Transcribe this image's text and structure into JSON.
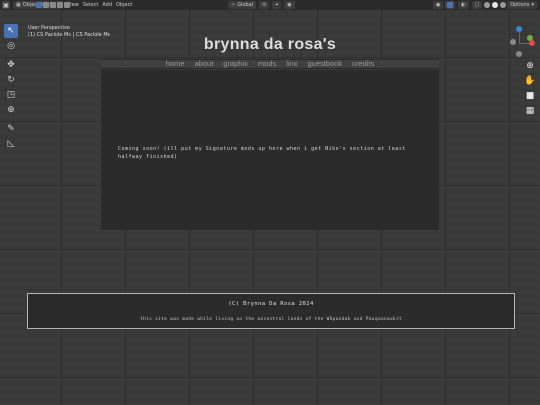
{
  "header": {
    "editor_icon": "viewport-icon",
    "mode_label": "Object Mode",
    "menus": [
      "View",
      "Select",
      "Add",
      "Object"
    ],
    "transform_orientation": "Global",
    "options_label": "Options"
  },
  "viewport": {
    "perspective_label": "User Perspective",
    "collection_label": "(1) CS Paclole Mc | CS Paclole Mc"
  },
  "toolbar": {
    "tools": [
      {
        "name": "select-box-icon",
        "glyph": "↖",
        "active": true
      },
      {
        "name": "cursor-icon",
        "glyph": "◎",
        "active": false
      },
      {
        "name": "move-icon",
        "glyph": "✥",
        "active": false
      },
      {
        "name": "rotate-icon",
        "glyph": "↻",
        "active": false
      },
      {
        "name": "scale-icon",
        "glyph": "◳",
        "active": false
      },
      {
        "name": "transform-icon",
        "glyph": "⊕",
        "active": false
      },
      {
        "name": "annotate-icon",
        "glyph": "✎",
        "active": false
      },
      {
        "name": "measure-icon",
        "glyph": "📐",
        "active": false
      }
    ]
  },
  "gizmo": {
    "colors": {
      "x": "#e04a4a",
      "y": "#6fb13c",
      "z": "#3e86d8",
      "neg": "#8a8a8a"
    }
  },
  "site": {
    "title": "brynna da rosa's",
    "nav": [
      "home",
      "about",
      "graphix",
      "mods",
      "linx",
      "guestbook",
      "credits"
    ],
    "content": "Coming soon! (ill put my Signature mods up here when i get Niko's section at least halfway finished)",
    "footer_copy": "(C) Brynna Da Rosa 2024",
    "footer_note": "this site was made while living on the ancestral lands of the Wôpanâak and Pauquunaukit"
  },
  "colors": {
    "accent": "#4772b3",
    "header_bg": "#2b2b2b",
    "viewport_bg": "#3b3b3b",
    "content_bg": "#2b2b2b"
  }
}
